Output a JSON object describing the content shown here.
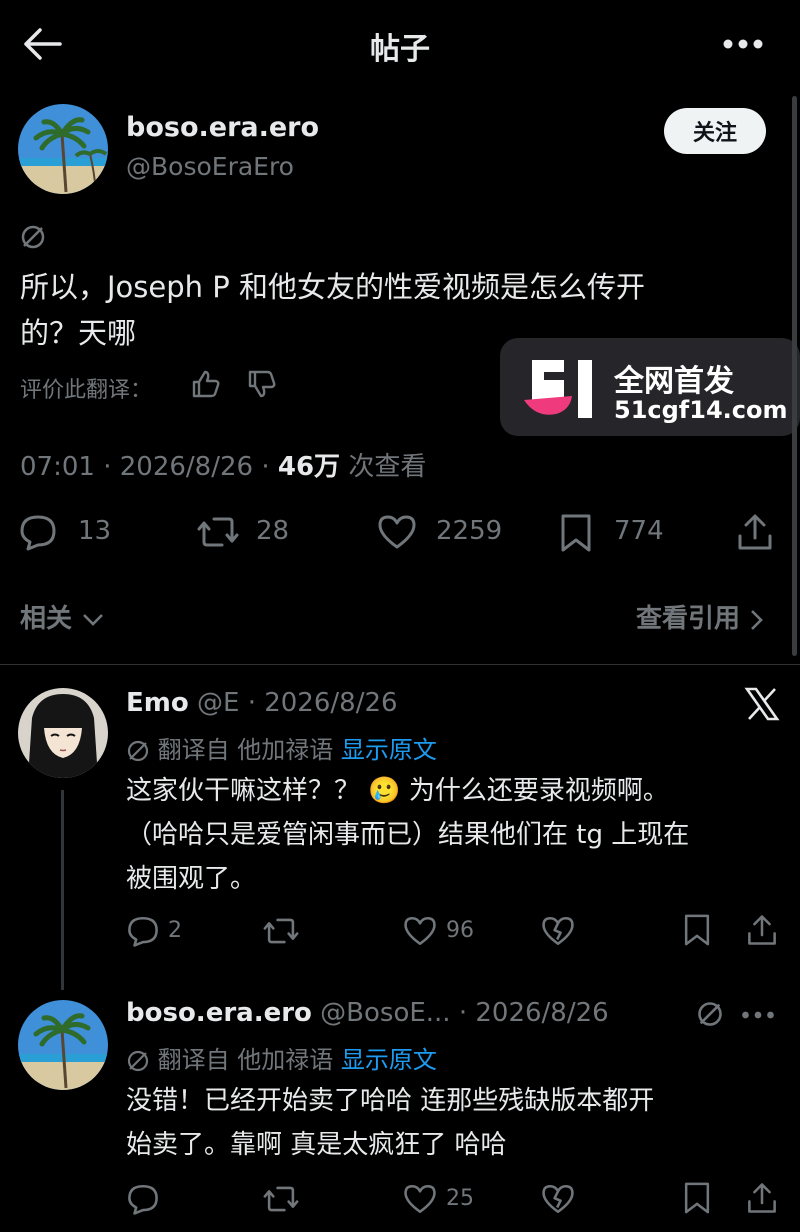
{
  "header": {
    "title": "帖子"
  },
  "post": {
    "display_name": "boso.era.ero",
    "handle": "@BosoEraEro",
    "follow_label": "关注",
    "text_line1": "所以，Joseph P 和他女友的性爱视频是怎么传开",
    "text_line2": "的？天哪",
    "rate_translation_label": "评价此翻译：",
    "time": "07:01",
    "date": "2026/8/26",
    "views_count": "46万",
    "views_label": "次查看",
    "stats": {
      "replies": "13",
      "reposts": "28",
      "likes": "2259",
      "bookmarks": "774"
    },
    "related_label": "相关",
    "view_quotes_label": "查看引用"
  },
  "watermark": {
    "title": "全网首发",
    "url": "51cgf14.com"
  },
  "replies": [
    {
      "name": "Emo",
      "handle": "@E",
      "date": "2026/8/26",
      "translated_label": "翻译自 他加禄语",
      "show_original": "显示原文",
      "line1": "这家伙干嘛这样？？ 🥲 为什么还要录视频啊。",
      "line2": "（哈哈只是爱管闲事而已）结果他们在 tg 上现在",
      "line3": "被围观了。",
      "replies": "2",
      "likes": "96"
    },
    {
      "name": "boso.era.ero",
      "handle": "@BosoE...",
      "date": "2026/8/26",
      "translated_label": "翻译自 他加禄语",
      "show_original": "显示原文",
      "line1": "没错！已经开始卖了哈哈 连那些残缺版本都开",
      "line2": "始卖了。靠啊 真是太疯狂了 哈哈",
      "likes": "25"
    }
  ]
}
